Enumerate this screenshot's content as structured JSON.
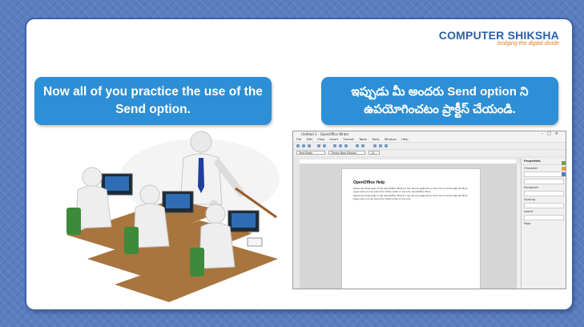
{
  "logo": {
    "brand_part1": "COMPUTER",
    "brand_part2": "SHIKSHA",
    "tagline": "bridging the digital divide"
  },
  "left_bubble": {
    "text": "Now all of you practice the use of the Send option."
  },
  "right_bubble": {
    "text": "ఇప్పుడు మీ అందరు Send option ని ఉపయోగించటం ప్రాక్టీస్ చేయండి."
  },
  "screenshot": {
    "window_title": "Untitled 1 - OpenOffice Writer",
    "menu": [
      "File",
      "Edit",
      "View",
      "Insert",
      "Format",
      "Table",
      "Tools",
      "Window",
      "Help"
    ],
    "style_box": "Text Body",
    "font_box": "Times New Roman",
    "size_box": "12",
    "doc_title": "OpenOffice Help",
    "doc_paragraph_1": "Opens the main page of the OpenOffice Help for the current application. You can scroll through the Help pages and you can search for index terms or any text. OpenOffice Help",
    "doc_paragraph_2": "Opens the main page of the OpenOffice Help for the current application. You can scroll through the Help pages and you can search for index terms or any text.",
    "sidebar_title": "Properties",
    "sidebar_sections": [
      "Character",
      "Paragraph",
      "Spacing",
      "Indent",
      "Page"
    ]
  },
  "colors": {
    "background": "#5a7dc0",
    "bubble": "#2d8fd5",
    "logo_blue": "#2c5fa8",
    "logo_orange": "#e07b24"
  }
}
